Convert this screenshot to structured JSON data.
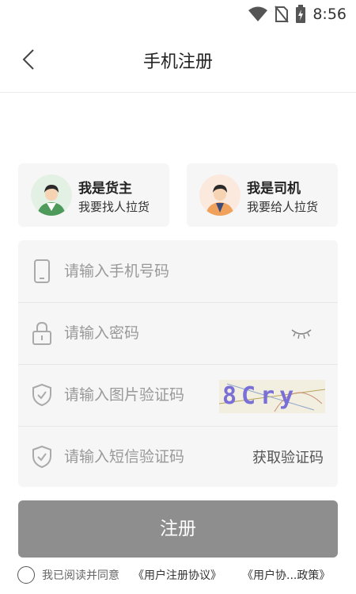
{
  "status": {
    "time": "8:56"
  },
  "header": {
    "title": "手机注册"
  },
  "roles": [
    {
      "title": "我是货主",
      "subtitle": "我要找人拉货"
    },
    {
      "title": "我是司机",
      "subtitle": "我要给人拉货"
    }
  ],
  "form": {
    "phone_placeholder": "请输入手机号码",
    "password_placeholder": "请输入密码",
    "image_code_placeholder": "请输入图片验证码",
    "captcha_text": "8Cry",
    "sms_code_placeholder": "请输入短信验证码",
    "get_code_label": "获取验证码"
  },
  "submit_label": "注册",
  "agreement": {
    "prefix": "我已阅读并同意",
    "user_agreement": "《用户注册协议》",
    "privacy_policy": "《用户协...政策》"
  },
  "colors": {
    "submit_bg": "#8e8e8e",
    "card_bg": "#f6f6f6"
  }
}
